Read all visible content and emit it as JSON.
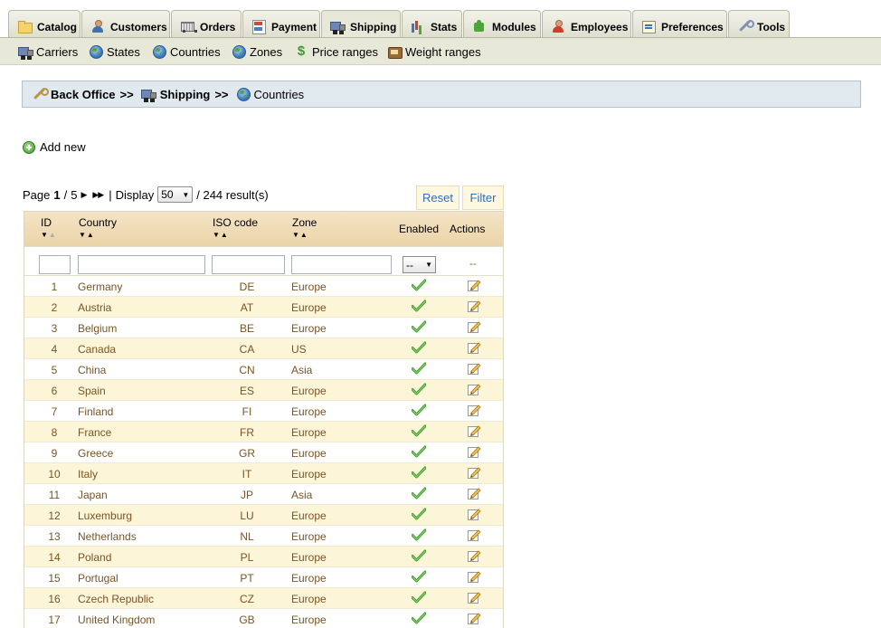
{
  "tabs": [
    {
      "key": "catalog",
      "label": "Catalog",
      "icon": "folder-icon"
    },
    {
      "key": "customers",
      "label": "Customers",
      "icon": "user-icon"
    },
    {
      "key": "orders",
      "label": "Orders",
      "icon": "cart-icon"
    },
    {
      "key": "payment",
      "label": "Payment",
      "icon": "payment-icon"
    },
    {
      "key": "shipping",
      "label": "Shipping",
      "icon": "truck-icon"
    },
    {
      "key": "stats",
      "label": "Stats",
      "icon": "stats-icon"
    },
    {
      "key": "modules",
      "label": "Modules",
      "icon": "puzzle-icon"
    },
    {
      "key": "employees",
      "label": "Employees",
      "icon": "employee-icon"
    },
    {
      "key": "preferences",
      "label": "Preferences",
      "icon": "preferences-icon"
    },
    {
      "key": "tools",
      "label": "Tools",
      "icon": "wrench-icon"
    }
  ],
  "active_tab": "Shipping",
  "subtabs": [
    {
      "label": "Carriers",
      "icon": "truck-icon"
    },
    {
      "label": "States",
      "icon": "globe-icon"
    },
    {
      "label": "Countries",
      "icon": "globe-icon"
    },
    {
      "label": "Zones",
      "icon": "globe-icon"
    },
    {
      "label": "Price ranges",
      "icon": "dollar-icon"
    },
    {
      "label": "Weight ranges",
      "icon": "scale-icon"
    }
  ],
  "breadcrumb": {
    "root": "Back Office",
    "separator": ">>",
    "section": "Shipping",
    "current": "Countries"
  },
  "add_new_label": "Add new",
  "pagination": {
    "page_label": "Page",
    "current_page": "1",
    "separator": "/",
    "total_pages": "5",
    "display_label": "Display",
    "per_page": "50",
    "results_text": "/ 244 result(s)"
  },
  "buttons": {
    "reset": "Reset",
    "filter": "Filter"
  },
  "columns": {
    "id": "ID",
    "country": "Country",
    "iso": "ISO code",
    "zone": "Zone",
    "enabled": "Enabled",
    "actions": "Actions"
  },
  "filters": {
    "enabled_value": "--",
    "actions_placeholder": "--"
  },
  "colors": {
    "row_text": "#7a5424",
    "row_alt_bg": "#fdf5d8",
    "header_bg": "#ead3a8",
    "breadcrumb_bg": "#e0eaee",
    "subbar_bg": "#e8e8d8",
    "button_text": "#2d6fbe",
    "check_green": "#3f9a2e"
  },
  "rows": [
    {
      "id": "1",
      "country": "Germany",
      "iso": "DE",
      "zone": "Europe",
      "enabled": true
    },
    {
      "id": "2",
      "country": "Austria",
      "iso": "AT",
      "zone": "Europe",
      "enabled": true
    },
    {
      "id": "3",
      "country": "Belgium",
      "iso": "BE",
      "zone": "Europe",
      "enabled": true
    },
    {
      "id": "4",
      "country": "Canada",
      "iso": "CA",
      "zone": "US",
      "enabled": true
    },
    {
      "id": "5",
      "country": "China",
      "iso": "CN",
      "zone": "Asia",
      "enabled": true
    },
    {
      "id": "6",
      "country": "Spain",
      "iso": "ES",
      "zone": "Europe",
      "enabled": true
    },
    {
      "id": "7",
      "country": "Finland",
      "iso": "FI",
      "zone": "Europe",
      "enabled": true
    },
    {
      "id": "8",
      "country": "France",
      "iso": "FR",
      "zone": "Europe",
      "enabled": true
    },
    {
      "id": "9",
      "country": "Greece",
      "iso": "GR",
      "zone": "Europe",
      "enabled": true
    },
    {
      "id": "10",
      "country": "Italy",
      "iso": "IT",
      "zone": "Europe",
      "enabled": true
    },
    {
      "id": "11",
      "country": "Japan",
      "iso": "JP",
      "zone": "Asia",
      "enabled": true
    },
    {
      "id": "12",
      "country": "Luxemburg",
      "iso": "LU",
      "zone": "Europe",
      "enabled": true
    },
    {
      "id": "13",
      "country": "Netherlands",
      "iso": "NL",
      "zone": "Europe",
      "enabled": true
    },
    {
      "id": "14",
      "country": "Poland",
      "iso": "PL",
      "zone": "Europe",
      "enabled": true
    },
    {
      "id": "15",
      "country": "Portugal",
      "iso": "PT",
      "zone": "Europe",
      "enabled": true
    },
    {
      "id": "16",
      "country": "Czech Republic",
      "iso": "CZ",
      "zone": "Europe",
      "enabled": true
    },
    {
      "id": "17",
      "country": "United Kingdom",
      "iso": "GB",
      "zone": "Europe",
      "enabled": true
    }
  ]
}
